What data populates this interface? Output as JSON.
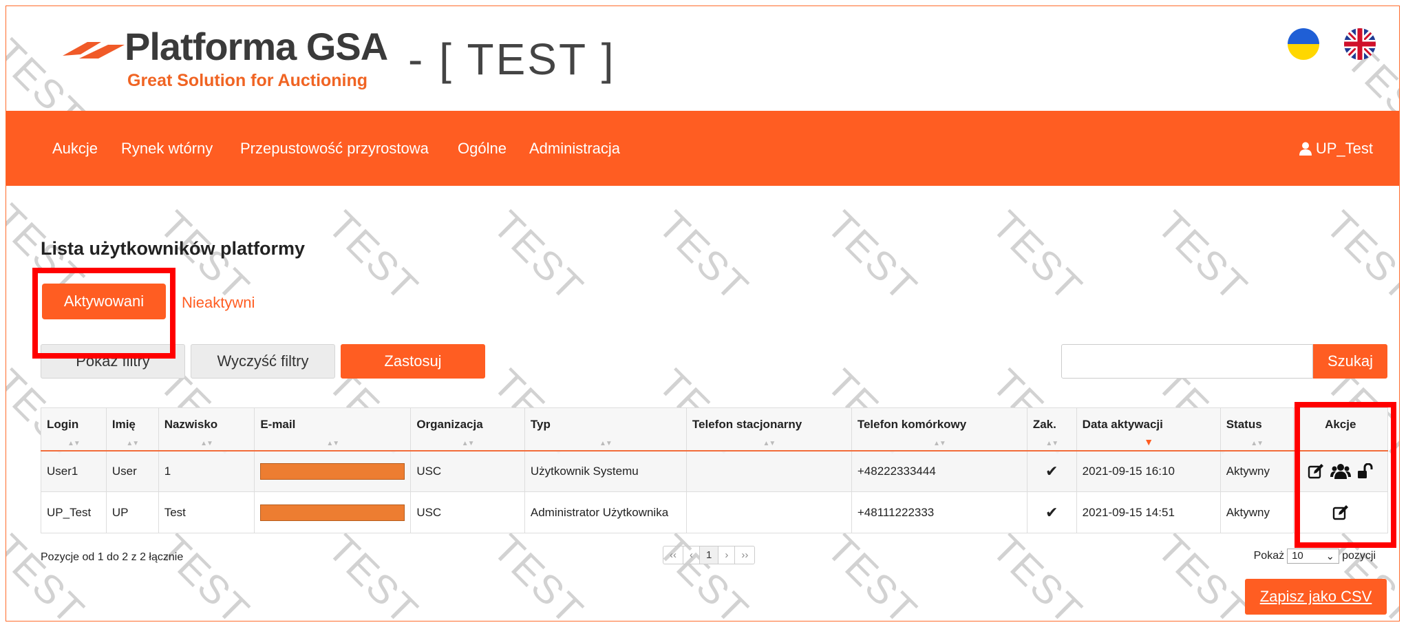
{
  "header": {
    "logo_title": "Platforma GSA",
    "logo_subtitle": "Great Solution for Auctioning",
    "env_label": "- [ TEST ]",
    "watermark": "TEST"
  },
  "nav": {
    "items": [
      "Aukcje",
      "Rynek wtórny",
      "Przepustowość przyrostowa",
      "Ogólne",
      "Administracja"
    ],
    "user": "UP_Test"
  },
  "page": {
    "title": "Lista użytkowników platformy",
    "tab_active": "Aktywowani",
    "tab_inactive": "Nieaktywni",
    "btn_show_filters": "Pokaż filtry",
    "btn_clear_filters": "Wyczyść filtry",
    "btn_apply": "Zastosuj",
    "search_value": "",
    "btn_search": "Szukaj"
  },
  "table": {
    "headers": [
      "Login",
      "Imię",
      "Nazwisko",
      "E-mail",
      "Organizacja",
      "Typ",
      "Telefon stacjonarny",
      "Telefon komórkowy",
      "Zak.",
      "Data aktywacji",
      "Status",
      "Akcje"
    ],
    "rows": [
      {
        "login": "User1",
        "imie": "User",
        "nazwisko": "1",
        "organizacja": "USC",
        "typ": "Użytkownik Systemu",
        "tel_stac": "",
        "tel_kom": "+48222333444",
        "zak": "✔",
        "data": "2021-09-15 16:10",
        "status": "Aktywny"
      },
      {
        "login": "UP_Test",
        "imie": "UP",
        "nazwisko": "Test",
        "organizacja": "USC",
        "typ": "Administrator Użytkownika",
        "tel_stac": "",
        "tel_kom": "+48111222333",
        "zak": "✔",
        "data": "2021-09-15 14:51",
        "status": "Aktywny"
      }
    ]
  },
  "footer": {
    "info": "Pozycje od 1 do 2 z 2 łącznie",
    "pager": [
      "‹‹",
      "‹",
      "1",
      "›",
      "››"
    ],
    "show_label": "Pokaż",
    "show_value": "10",
    "show_suffix": "pozycji",
    "csv": "Zapisz jako CSV"
  },
  "colors": {
    "accent": "#ff5d22",
    "highlight": "#ff0000",
    "redacted": "#ed7d31"
  },
  "icons": {
    "logo": "gsa-logo-icon",
    "user": "user-icon",
    "edit": "edit-icon",
    "users": "users-group-icon",
    "unlock": "unlock-icon",
    "check": "check-icon"
  }
}
